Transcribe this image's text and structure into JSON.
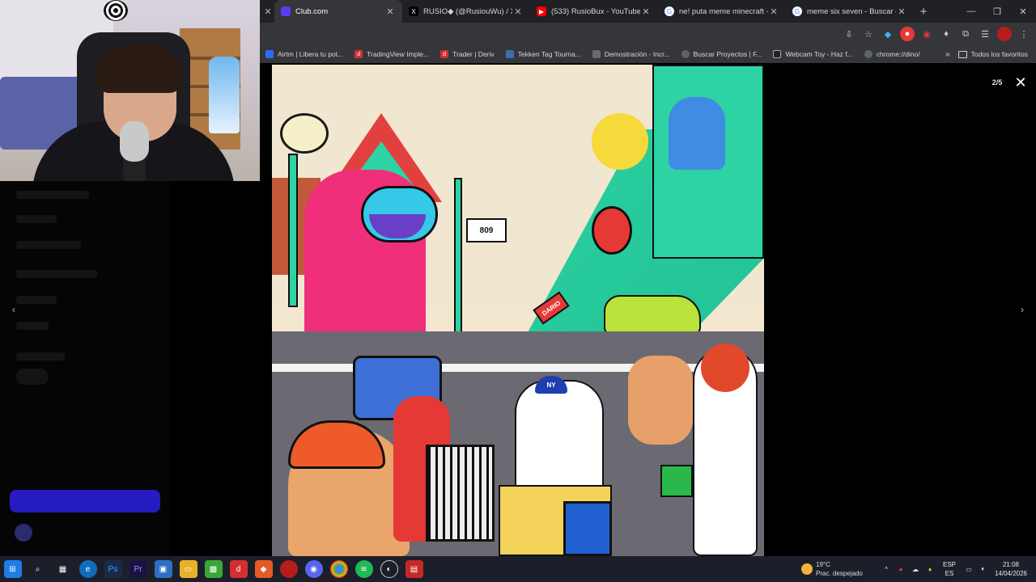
{
  "browser": {
    "tabs": [
      {
        "title": "Club.com",
        "favicon_color": "#5b3cf0",
        "active": true
      },
      {
        "title": "RUSIO◆ (@RusiouWu) / X",
        "favicon_color": "#000000",
        "favicon_glyph": "X",
        "active": false
      },
      {
        "title": "(533) RusioBux - YouTube",
        "favicon_color": "#ff0000",
        "favicon_glyph": "▶",
        "active": false
      },
      {
        "title": "ne! puta meme minecraft - Bus",
        "favicon_color": "#4285f4",
        "favicon_glyph": "G",
        "active": false
      },
      {
        "title": "meme six seven - Buscar con G",
        "favicon_color": "#4285f4",
        "favicon_glyph": "G",
        "active": false
      }
    ],
    "new_tab_glyph": "+",
    "bookmarks": [
      {
        "label": "Airtm | Libera tu pot...",
        "icon_color": "#2f6cf6"
      },
      {
        "label": "TradingView Imple...",
        "icon_color": "#d32f2f"
      },
      {
        "label": "Trader | Deriv",
        "icon_color": "#d32f2f"
      },
      {
        "label": "Tekken Tag Tourna...",
        "icon_color": "#3a6fb0"
      },
      {
        "label": "Demostración - Incr...",
        "icon_color": "#6b6b6b"
      },
      {
        "label": "Buscar Proyectos | F...",
        "icon_color": "#5f6368"
      },
      {
        "label": "Webcam Toy - Haz f...",
        "icon_color": "#222222"
      },
      {
        "label": "chrome://dino/",
        "icon_color": "#5f6368"
      }
    ],
    "bookmarks_more": "»",
    "all_bookmarks": "Todos los favoritos"
  },
  "viewer": {
    "counter": "2/5",
    "close_glyph": "✕",
    "prev_glyph": "‹",
    "next_glyph": "›"
  },
  "illustration": {
    "signs": [
      "809",
      "DARIO",
      "NY"
    ]
  },
  "taskbar": {
    "weather_temp": "19°C",
    "weather_desc": "Prac. despejado",
    "lang_top": "ESP",
    "lang_bottom": "ES",
    "time": "21:08",
    "date": "14/04/2026"
  }
}
